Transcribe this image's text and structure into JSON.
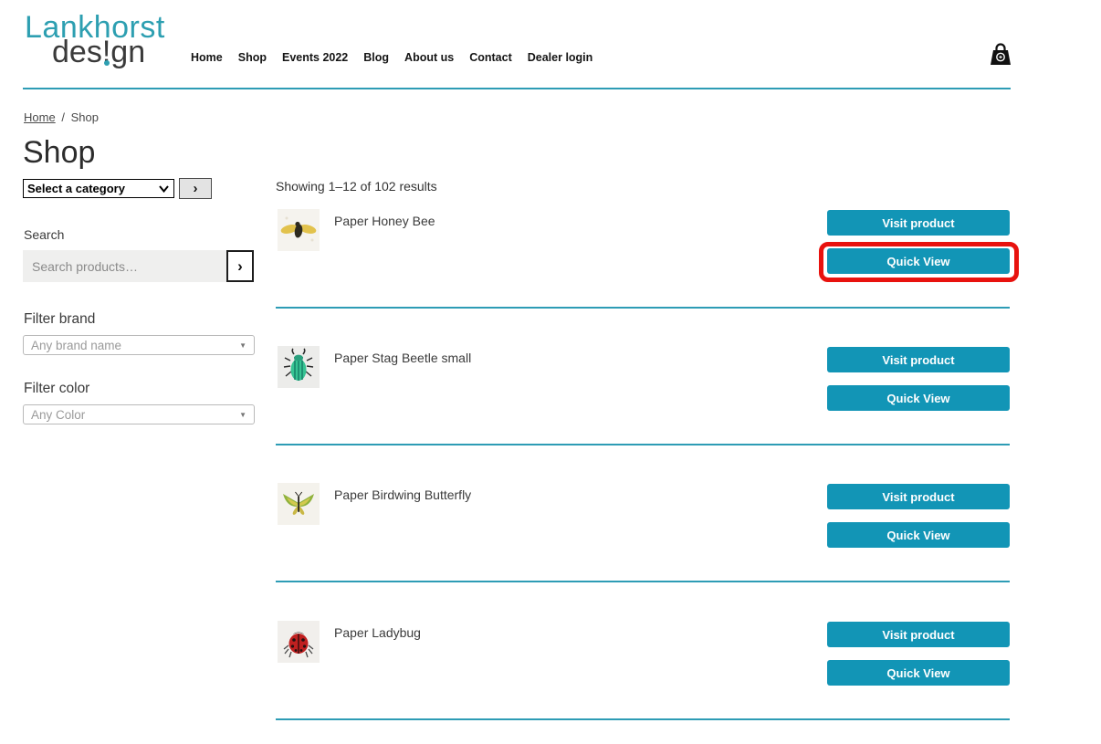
{
  "brand": {
    "name_line1": "Lankhorst",
    "name_line2_pre": "des",
    "name_bang": "!",
    "name_line2_post": "gn"
  },
  "header": {
    "nav": [
      {
        "label": "Home"
      },
      {
        "label": "Shop"
      },
      {
        "label": "Events 2022"
      },
      {
        "label": "Blog"
      },
      {
        "label": "About us"
      },
      {
        "label": "Contact"
      },
      {
        "label": "Dealer login"
      }
    ],
    "cart_icon": "shopping-bag-icon"
  },
  "breadcrumb": {
    "home": "Home",
    "separator": "/",
    "current": "Shop"
  },
  "sidebar": {
    "title": "Shop",
    "category": {
      "selected": "Select a category",
      "go_icon": "chevron-right-icon",
      "go_glyph": "›"
    },
    "search": {
      "label": "Search",
      "placeholder": "Search products…",
      "go_glyph": "›"
    },
    "brand_filter": {
      "label": "Filter brand",
      "placeholder": "Any brand name",
      "caret_glyph": "▼"
    },
    "color_filter": {
      "label": "Filter color",
      "placeholder": "Any Color",
      "caret_glyph": "▼"
    }
  },
  "main": {
    "results_text": "Showing 1–12 of 102 results",
    "visit_button_label": "Visit product",
    "quick_view_button_label": "Quick View",
    "products": [
      {
        "title": "Paper Honey Bee",
        "thumbnail": "honey-bee-thumbnail"
      },
      {
        "title": "Paper Stag Beetle small",
        "thumbnail": "stag-beetle-thumbnail"
      },
      {
        "title": "Paper Birdwing Butterfly",
        "thumbnail": "birdwing-butterfly-thumbnail"
      },
      {
        "title": "Paper Ladybug",
        "thumbnail": "ladybug-thumbnail"
      }
    ]
  },
  "annotation": {
    "type": "highlight-box",
    "target": "Quick View button of Paper Honey Bee",
    "color": "#e8120e"
  },
  "colors": {
    "accent_teal": "#1295b6",
    "line_teal": "#2d9cb5",
    "logo_teal": "#2d9fb1",
    "text_dark": "#3a3a3a",
    "highlight_red": "#e8120e"
  }
}
